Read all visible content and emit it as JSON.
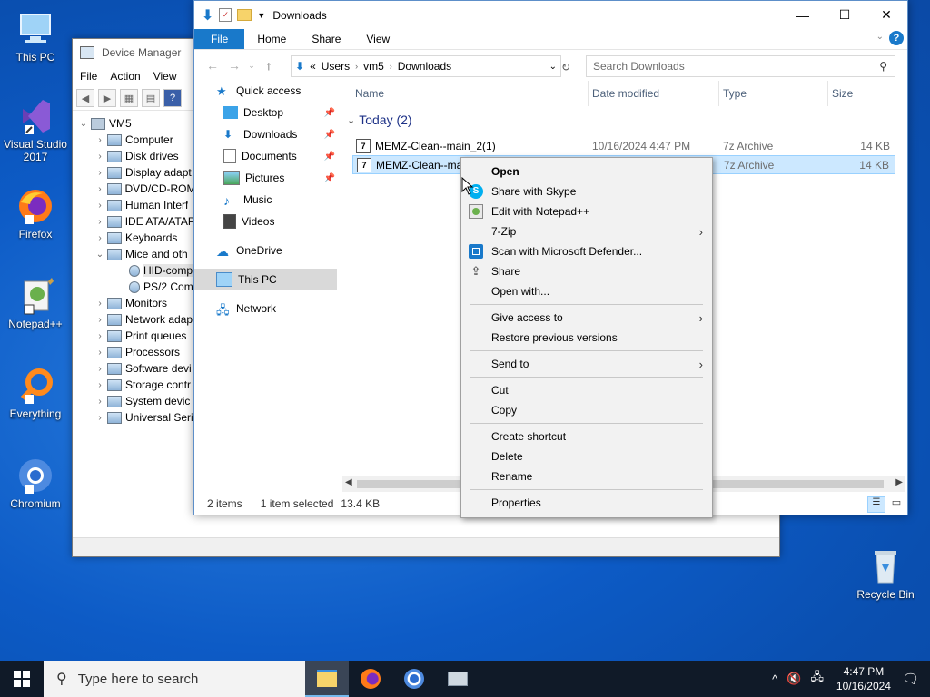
{
  "desktop": {
    "icons": [
      {
        "label": "This PC"
      },
      {
        "label": "Visual Studio 2017"
      },
      {
        "label": "Firefox"
      },
      {
        "label": "Notepad++"
      },
      {
        "label": "Everything"
      },
      {
        "label": "Chromium"
      },
      {
        "label": "Recycle Bin"
      }
    ]
  },
  "device_manager": {
    "title": "Device Manager",
    "menu": [
      "File",
      "Action",
      "View"
    ],
    "tree": [
      {
        "label": "VM5",
        "exp": "⌄"
      },
      {
        "label": "Computer",
        "exp": "›"
      },
      {
        "label": "Disk drives",
        "exp": "›"
      },
      {
        "label": "Display adapt",
        "exp": "›"
      },
      {
        "label": "DVD/CD-ROM",
        "exp": "›"
      },
      {
        "label": "Human Interf",
        "exp": "›"
      },
      {
        "label": "IDE ATA/ATAP",
        "exp": "›"
      },
      {
        "label": "Keyboards",
        "exp": "›"
      },
      {
        "label": "Mice and oth",
        "exp": "⌄"
      },
      {
        "label": "HID-comp",
        "exp": ""
      },
      {
        "label": "PS/2 Com",
        "exp": ""
      },
      {
        "label": "Monitors",
        "exp": "›"
      },
      {
        "label": "Network adap",
        "exp": "›"
      },
      {
        "label": "Print queues",
        "exp": "›"
      },
      {
        "label": "Processors",
        "exp": "›"
      },
      {
        "label": "Software devi",
        "exp": "›"
      },
      {
        "label": "Storage contr",
        "exp": "›"
      },
      {
        "label": "System devic",
        "exp": "›"
      },
      {
        "label": "Universal Seri",
        "exp": "›"
      }
    ]
  },
  "explorer": {
    "title": "Downloads",
    "window_controls": {
      "minimize": "—",
      "maximize": "☐",
      "close": "✕"
    },
    "ribbon_tabs": {
      "file": "File",
      "home": "Home",
      "share": "Share",
      "view": "View"
    },
    "address": {
      "prefix": "«",
      "crumbs": [
        "Users",
        "vm5",
        "Downloads"
      ]
    },
    "search_placeholder": "Search Downloads",
    "nav": {
      "quick_access": "Quick access",
      "desktop": "Desktop",
      "downloads": "Downloads",
      "documents": "Documents",
      "pictures": "Pictures",
      "music": "Music",
      "videos": "Videos",
      "onedrive": "OneDrive",
      "this_pc": "This PC",
      "network": "Network"
    },
    "columns": {
      "name": "Name",
      "date": "Date modified",
      "type": "Type",
      "size": "Size"
    },
    "group": "Today (2)",
    "files": [
      {
        "name": "MEMZ-Clean--main_2(1)",
        "date": "10/16/2024 4:47 PM",
        "type": "7z Archive",
        "size": "14 KB"
      },
      {
        "name": "MEMZ-Clean--ma",
        "date": "",
        "type": "7z Archive",
        "size": "14 KB"
      }
    ],
    "status": {
      "items": "2 items",
      "selected": "1 item selected",
      "size": "13.4 KB"
    }
  },
  "context_menu": {
    "open": "Open",
    "share_skype": "Share with Skype",
    "edit_npp": "Edit with Notepad++",
    "zip": "7-Zip",
    "defender": "Scan with Microsoft Defender...",
    "share": "Share",
    "open_with": "Open with...",
    "give_access": "Give access to",
    "restore": "Restore previous versions",
    "send_to": "Send to",
    "cut": "Cut",
    "copy": "Copy",
    "create_shortcut": "Create shortcut",
    "delete": "Delete",
    "rename": "Rename",
    "properties": "Properties"
  },
  "taskbar": {
    "search_placeholder": "Type here to search",
    "time": "4:47 PM",
    "date": "10/16/2024"
  }
}
